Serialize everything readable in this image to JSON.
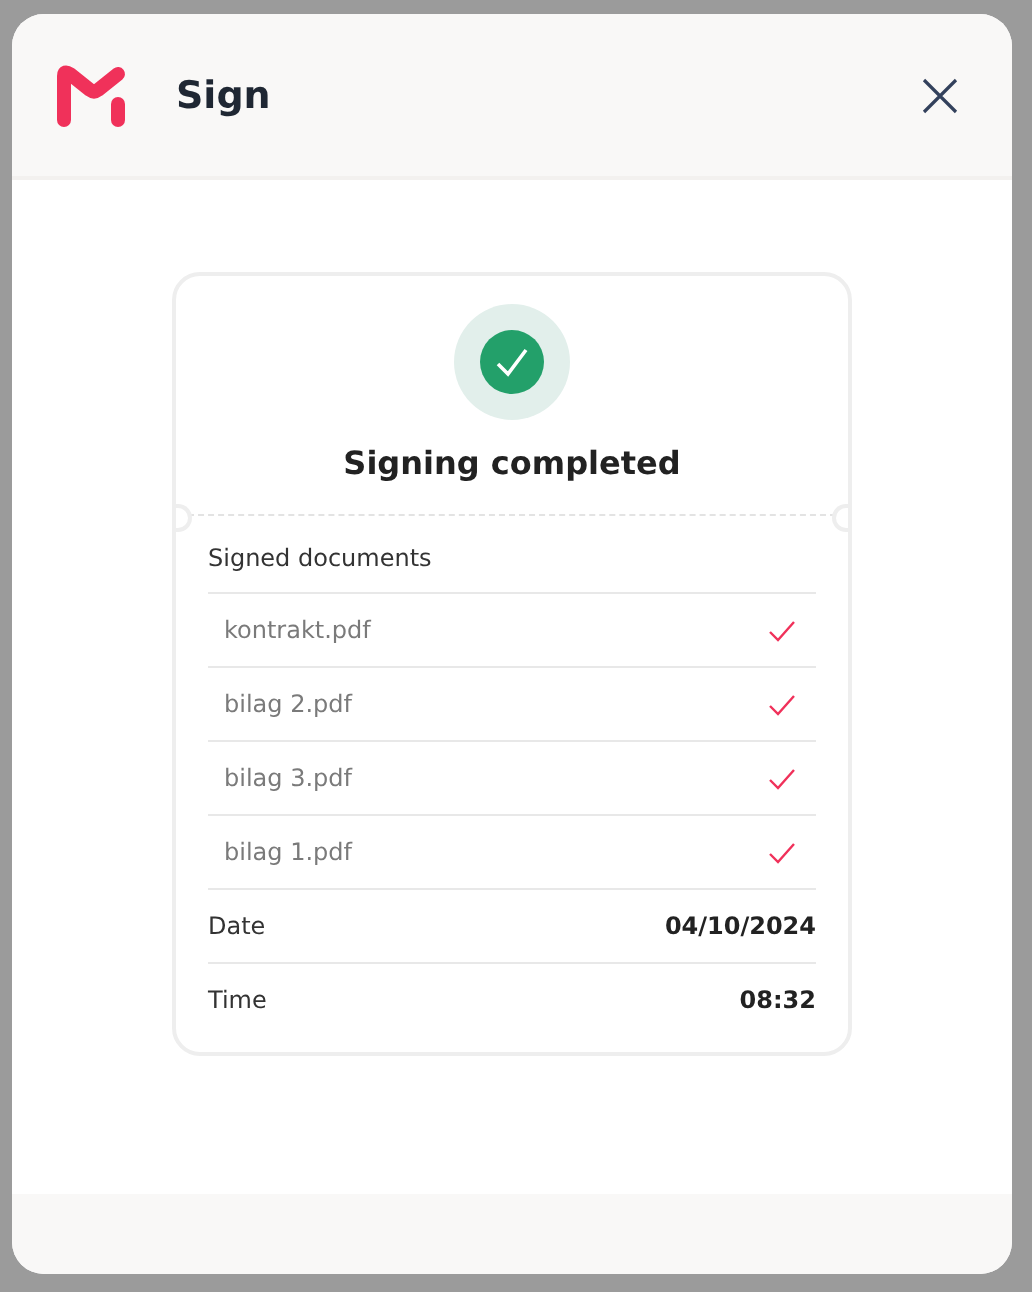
{
  "dialog": {
    "title": "Sign"
  },
  "status": {
    "title": "Signing completed"
  },
  "documents": {
    "heading": "Signed documents",
    "items": [
      {
        "name": "kontrakt.pdf",
        "signed": true
      },
      {
        "name": "bilag 2.pdf",
        "signed": true
      },
      {
        "name": "bilag 3.pdf",
        "signed": true
      },
      {
        "name": "bilag 1.pdf",
        "signed": true
      }
    ]
  },
  "details": [
    {
      "label": "Date",
      "value": "04/10/2024"
    },
    {
      "label": "Time",
      "value": "08:32"
    }
  ]
}
